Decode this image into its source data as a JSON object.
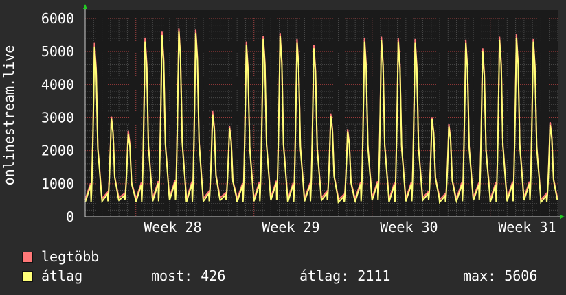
{
  "chart_data": {
    "type": "line",
    "ylabel": "onlinestream.live",
    "ylim": [
      0,
      6000
    ],
    "y_ticks": [
      0,
      1000,
      2000,
      3000,
      4000,
      5000,
      6000
    ],
    "x_ticks": [
      "Week 28",
      "Week 29",
      "Week 30",
      "Week 31"
    ],
    "grid": true,
    "legend_position": "bottom",
    "daily_peaks": {
      "legtobb": [
        5280,
        3040,
        2600,
        5420,
        5620,
        5700,
        5660,
        3200,
        2750,
        5300,
        5480,
        5560,
        5380,
        5200,
        3120,
        2650,
        5420,
        5450,
        5400,
        5380,
        3000,
        2800,
        5360,
        5100,
        5450,
        5520,
        5380,
        2860
      ],
      "atlag": [
        5150,
        2980,
        2500,
        5300,
        5500,
        5620,
        5560,
        3100,
        2680,
        5200,
        5380,
        5480,
        5280,
        5100,
        3050,
        2580,
        5300,
        5350,
        5300,
        5280,
        2950,
        2730,
        5260,
        5000,
        5360,
        5420,
        5300,
        2780
      ]
    },
    "series": [
      {
        "name": "legtöbb",
        "color": "#ff7878"
      },
      {
        "name": "átlag",
        "color": "#ffff78"
      }
    ]
  },
  "legend": {
    "legtobb": "legtöbb",
    "atlag": "átlag"
  },
  "stats": {
    "most": "most: 426",
    "atlag": "átlag: 2111",
    "max": "max: 5606"
  },
  "colors": {
    "background": "#2b2b2b",
    "plot_background": "#1a1a1a",
    "grid_major": "#9a3a3a",
    "grid_minor": "#4a4a4a",
    "axis_arrow": "#22cc22"
  }
}
